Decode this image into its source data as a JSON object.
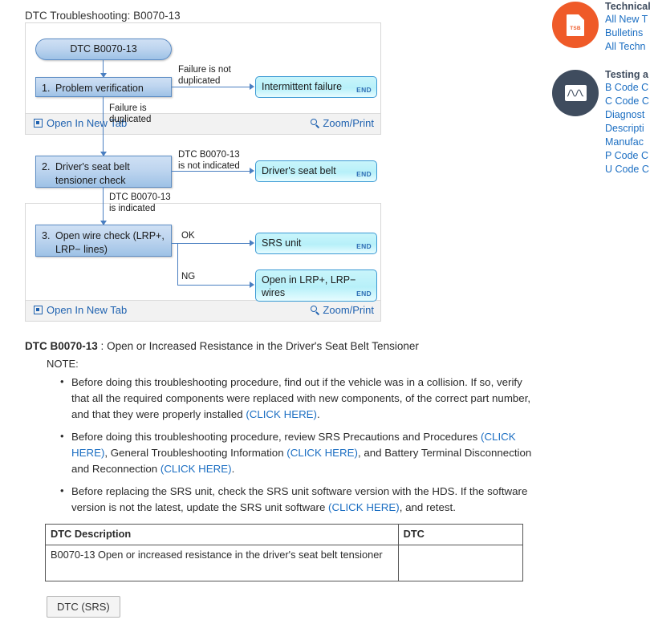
{
  "chart_caption": "DTC Troubleshooting: B0070-13",
  "flowchart_1": {
    "nodes": {
      "start": "DTC B0070-13",
      "step1_num": "1.",
      "step1_text": "Problem verification",
      "end_intermittent": "Intermittent failure",
      "end_tag": "END"
    },
    "edges": {
      "not_duplicated": "Failure is not\nduplicated",
      "duplicated": "Failure is\nduplicated"
    },
    "footer": {
      "open_in_new_tab": "Open In New Tab",
      "zoom_print": "Zoom/Print"
    }
  },
  "flowchart_2": {
    "nodes": {
      "step2_num": "2.",
      "step2_line1": "Driver's seat belt",
      "step2_line2": "tensioner check",
      "end_seatbelt": "Driver's seat belt",
      "step3_num": "3.",
      "step3_line1": "Open wire check (LRP+,",
      "step3_line2": "LRP−  lines)",
      "end_srs": "SRS unit",
      "end_open_line1": "Open in LRP+, LRP−",
      "end_open_line2": "wires",
      "end_tag": "END"
    },
    "edges": {
      "not_indicated": "DTC B0070-13\nis not indicated",
      "indicated": "DTC B0070-13\nis indicated",
      "ok": "OK",
      "ng": "NG"
    },
    "footer": {
      "open_in_new_tab": "Open In New Tab",
      "zoom_print": "Zoom/Print"
    }
  },
  "document": {
    "dtc_code": "DTC B0070-13",
    "dtc_separator": " : ",
    "dtc_title": "Open or Increased Resistance in the Driver's Seat Belt Tensioner",
    "note_label": "NOTE:",
    "notes": [
      {
        "parts": [
          {
            "type": "text",
            "value": "Before doing this troubleshooting procedure, find out if the vehicle was in a collision. If so, verify that all the required components were replaced with new components, of the correct part number, and that they were properly installed "
          },
          {
            "type": "link",
            "value": "(CLICK HERE)"
          },
          {
            "type": "text",
            "value": "."
          }
        ]
      },
      {
        "parts": [
          {
            "type": "text",
            "value": "Before doing this troubleshooting procedure, review SRS Precautions and Procedures "
          },
          {
            "type": "link",
            "value": "(CLICK HERE)"
          },
          {
            "type": "text",
            "value": ", General Troubleshooting Information "
          },
          {
            "type": "link",
            "value": "(CLICK HERE)"
          },
          {
            "type": "text",
            "value": ", and Battery Terminal Disconnection and Reconnection "
          },
          {
            "type": "link",
            "value": "(CLICK HERE)"
          },
          {
            "type": "text",
            "value": "."
          }
        ]
      },
      {
        "parts": [
          {
            "type": "text",
            "value": "Before replacing the SRS unit, check the SRS unit software version with the HDS. If the software version is not the latest, update the SRS unit software "
          },
          {
            "type": "link",
            "value": "(CLICK HERE)"
          },
          {
            "type": "text",
            "value": ", and retest."
          }
        ]
      }
    ]
  },
  "table": {
    "headers": [
      "DTC Description",
      "DTC"
    ],
    "rows": [
      [
        "B0070-13 Open or increased resistance in the driver's seat belt tensioner",
        ""
      ]
    ]
  },
  "bottom_button": {
    "label": "DTC (SRS)"
  },
  "sidebar": {
    "groups": [
      {
        "icon": "tsb-document-icon",
        "icon_text": "TSB",
        "icon_color": "#ef5a28",
        "title": "Technical",
        "links": [
          "All New T",
          "Bulletins",
          "All Techn"
        ]
      },
      {
        "icon": "oscilloscope-icon",
        "icon_color": "#3f4c5e",
        "title": "Testing a",
        "links": [
          "B Code C",
          "C Code C",
          "Diagnost",
          "Descripti",
          "Manufac",
          "P Code C",
          "U Code C"
        ]
      }
    ]
  },
  "colors": {
    "link": "#1b6ec2",
    "node_blue_border": "#5c8cc4",
    "node_end_border": "#3c9ad4",
    "connector": "#4a7fc1",
    "tsb_orange": "#ef5a28",
    "scope_slate": "#3f4c5e"
  }
}
